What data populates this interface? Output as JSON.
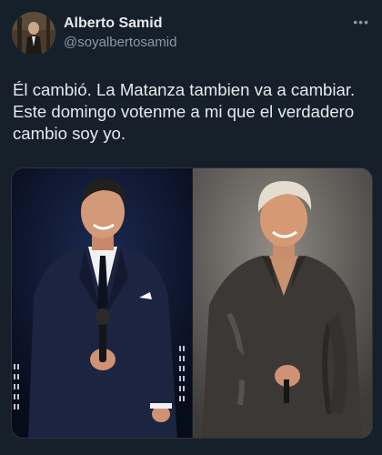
{
  "tweet": {
    "display_name": "Alberto Samid",
    "handle": "@soyalbertosamid",
    "more_icon": "more-dots-icon",
    "lines": [
      "Él cambió. La Matanza tambien va a cambiar.",
      "Este domingo votenme a mi que el verdadero",
      "cambio soy yo."
    ]
  },
  "media": {
    "left_photo": "singer-in-dark-suit-stage-photo",
    "right_photo": "singer-in-satin-shirt-stage-photo"
  }
}
